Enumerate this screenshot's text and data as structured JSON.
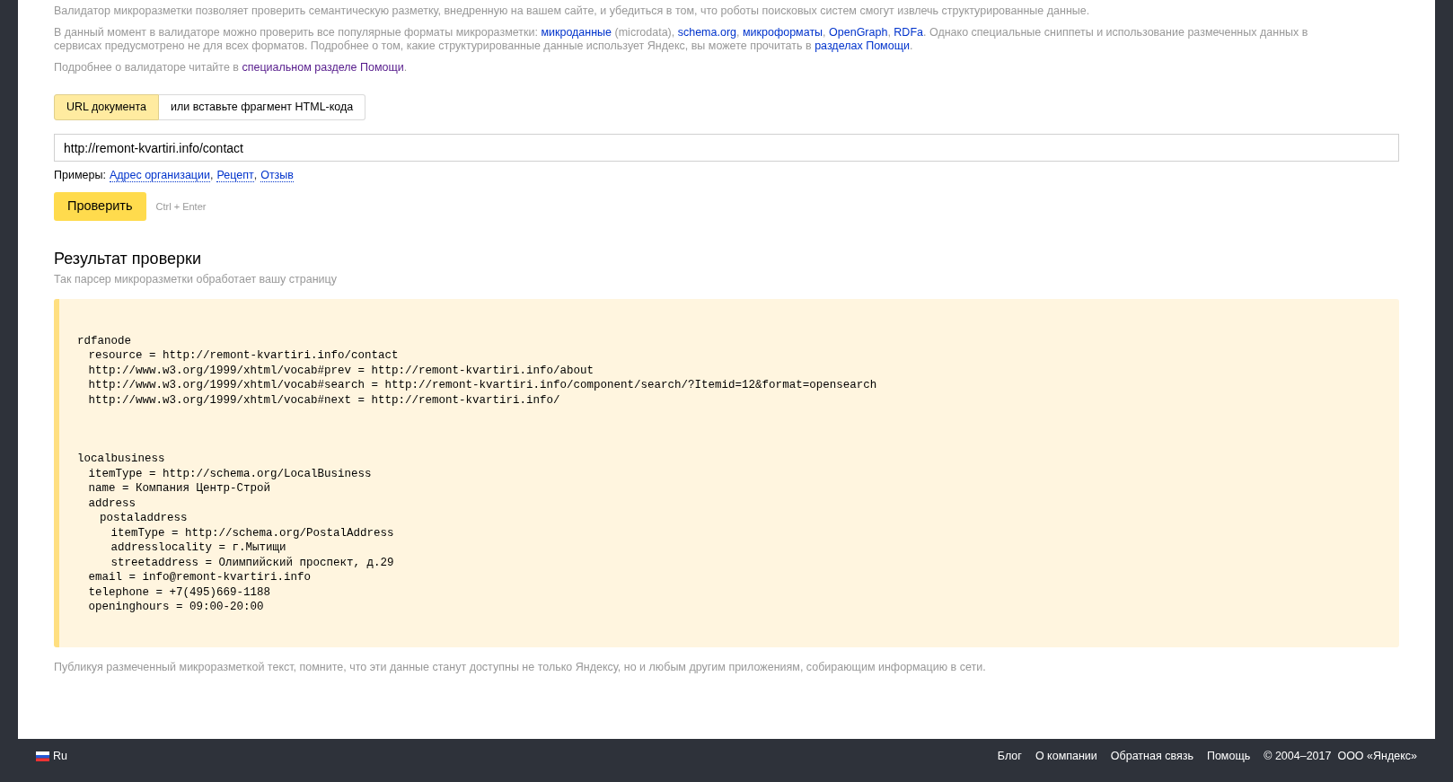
{
  "intro": [
    [
      {
        "kind": "text",
        "text": "Валидатор микроразметки позволяет проверить семантическую разметку, внедренную на вашем сайте, и убедиться в том, что роботы поисковых систем смогут извлечь структурированные данные."
      }
    ],
    [
      {
        "kind": "text",
        "text": "В данный момент в валидаторе можно проверить все популярные форматы микроразметки: "
      },
      {
        "kind": "link",
        "visited": false,
        "text": "микроданные"
      },
      {
        "kind": "text",
        "text": " (microdata), "
      },
      {
        "kind": "link",
        "visited": false,
        "text": "schema.org"
      },
      {
        "kind": "text",
        "text": ", "
      },
      {
        "kind": "link",
        "visited": false,
        "text": "микроформаты"
      },
      {
        "kind": "text",
        "text": ", "
      },
      {
        "kind": "link",
        "visited": false,
        "text": "OpenGraph"
      },
      {
        "kind": "text",
        "text": ", "
      },
      {
        "kind": "link",
        "visited": false,
        "text": "RDFa"
      },
      {
        "kind": "text",
        "text": ". Однако специальные сниппеты и использование размеченных данных в сервисах предусмотрено не для всех форматов. Подробнее о том, какие структурированные данные использует Яндекс, вы можете прочитать в "
      },
      {
        "kind": "link",
        "visited": false,
        "text": "разделах Помощи"
      },
      {
        "kind": "text",
        "text": "."
      }
    ],
    [
      {
        "kind": "text",
        "text": "Подробнее о валидаторе читайте в "
      },
      {
        "kind": "link",
        "visited": true,
        "text": "специальном разделе Помощи"
      },
      {
        "kind": "text",
        "text": "."
      }
    ]
  ],
  "tabs": [
    {
      "label": "URL документа",
      "selected": true
    },
    {
      "label": "или вставьте фрагмент HTML-кода",
      "selected": false
    }
  ],
  "url_field": {
    "value": "http://remont-kvartiri.info/contact"
  },
  "examples": {
    "label": "Примеры:",
    "links": [
      "Адрес организации",
      "Рецепт",
      "Отзыв"
    ],
    "separator": ","
  },
  "check_button": "Проверить",
  "shortcut": "Ctrl + Enter",
  "result": {
    "title": "Результат проверки",
    "subtitle": "Так парсер микроразметки обработает вашу страницу",
    "blocks": [
      {
        "text": "rdfanode",
        "children": [
          {
            "text": "resource = http://remont-kvartiri.info/contact"
          },
          {
            "text": "http://www.w3.org/1999/xhtml/vocab#prev = http://remont-kvartiri.info/about"
          },
          {
            "text": "http://www.w3.org/1999/xhtml/vocab#search = http://remont-kvartiri.info/component/search/?Itemid=12&format=opensearch"
          },
          {
            "text": "http://www.w3.org/1999/xhtml/vocab#next = http://remont-kvartiri.info/"
          }
        ]
      },
      {
        "text": "localbusiness",
        "children": [
          {
            "text": "itemType = http://schema.org/LocalBusiness"
          },
          {
            "text": "name = Компания Центр-Строй"
          },
          {
            "text": "address",
            "children": [
              {
                "text": "postaladdress",
                "children": [
                  {
                    "text": "itemType = http://schema.org/PostalAddress"
                  },
                  {
                    "text": "addresslocality = г.Мытищи"
                  },
                  {
                    "text": "streetaddress = Олимпийский проспект, д.29"
                  }
                ]
              }
            ]
          },
          {
            "text": "email = info@remont-kvartiri.info"
          },
          {
            "text": "telephone = +7(495)669-1188"
          },
          {
            "text": "openinghours = 09:00-20:00"
          }
        ]
      }
    ]
  },
  "note": "Публикуя размеченный микроразметкой текст, помните, что эти данные станут доступны не только Яндексу, но и любым другим приложениям, собирающим информацию в сети.",
  "footer": {
    "language": "Ru",
    "links": [
      "Блог",
      "О компании",
      "Обратная связь",
      "Помощь"
    ],
    "copyright": "© 2004–2017  ООО «Яндекс»"
  }
}
